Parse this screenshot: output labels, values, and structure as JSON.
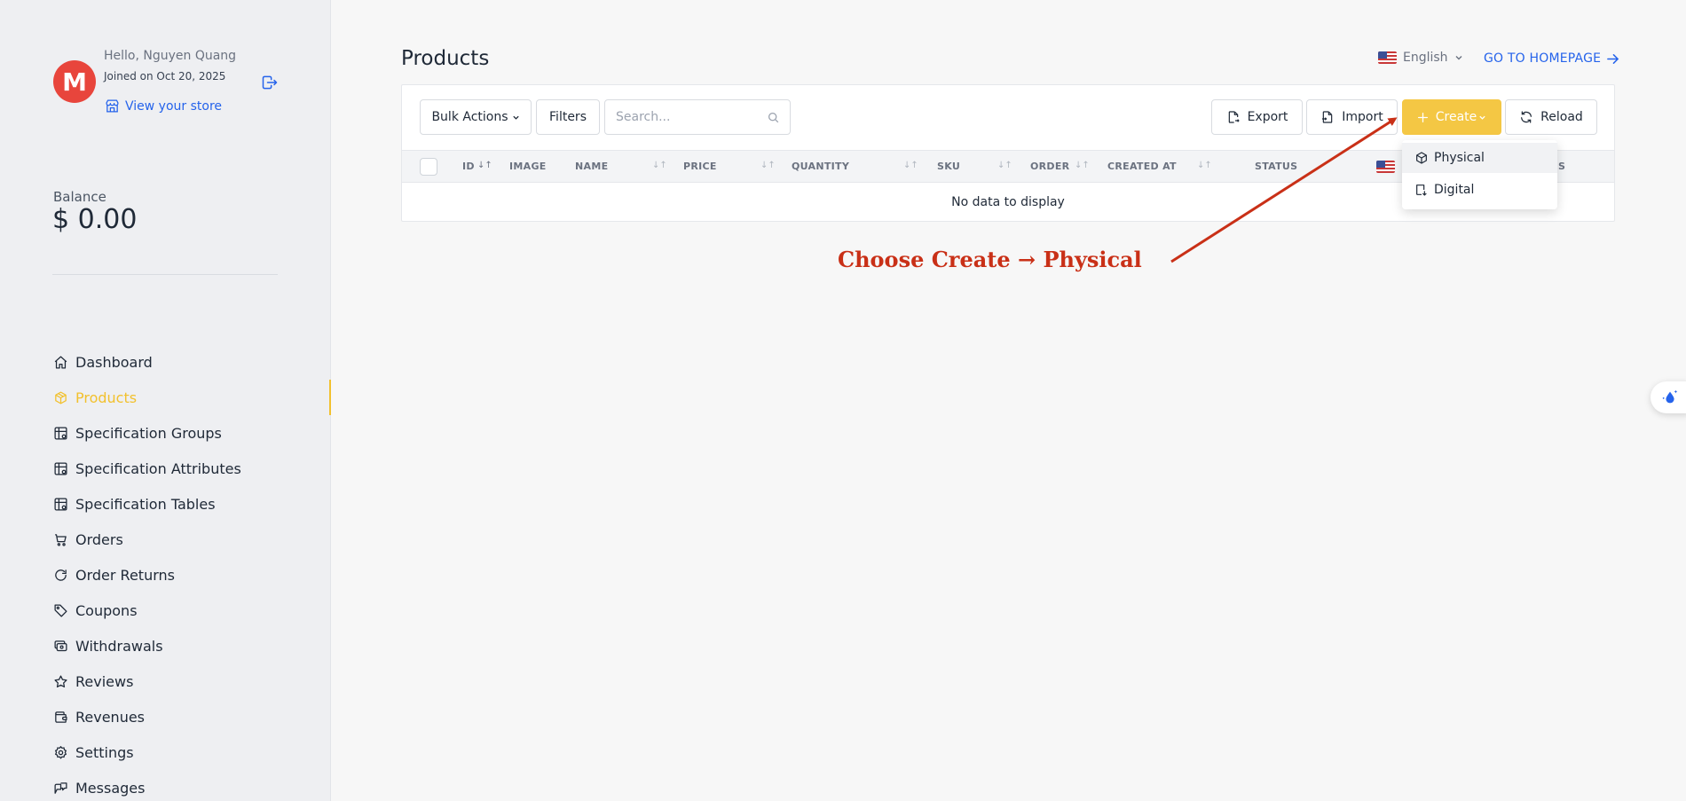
{
  "user": {
    "avatar_letter": "M",
    "greeting": "Hello, Nguyen Quang",
    "joined": "Joined on Oct 20, 2025",
    "store_link": "View your store"
  },
  "balance": {
    "label": "Balance",
    "value": "$ 0.00"
  },
  "nav": [
    {
      "label": "Dashboard",
      "icon": "home-icon"
    },
    {
      "label": "Products",
      "icon": "package-icon",
      "active": true
    },
    {
      "label": "Specification Groups",
      "icon": "table-gear-icon"
    },
    {
      "label": "Specification Attributes",
      "icon": "table-gear-icon"
    },
    {
      "label": "Specification Tables",
      "icon": "table-gear-icon"
    },
    {
      "label": "Orders",
      "icon": "cart-icon"
    },
    {
      "label": "Order Returns",
      "icon": "refresh-icon"
    },
    {
      "label": "Coupons",
      "icon": "tag-icon"
    },
    {
      "label": "Withdrawals",
      "icon": "cash-icon"
    },
    {
      "label": "Reviews",
      "icon": "star-icon"
    },
    {
      "label": "Revenues",
      "icon": "wallet-icon"
    },
    {
      "label": "Settings",
      "icon": "gear-icon"
    },
    {
      "label": "Messages",
      "icon": "message-icon"
    }
  ],
  "header": {
    "title": "Products",
    "language": "English",
    "home_link": "GO TO HOMEPAGE"
  },
  "toolbar": {
    "bulk_actions": "Bulk Actions",
    "filters": "Filters",
    "search_placeholder": "Search...",
    "export": "Export",
    "import": "Import",
    "create": "Create",
    "reload": "Reload"
  },
  "table": {
    "columns": [
      "ID",
      "IMAGE",
      "NAME",
      "PRICE",
      "QUANTITY",
      "SKU",
      "ORDER",
      "CREATED AT",
      "STATUS"
    ],
    "empty": "No data to display",
    "hidden_column_tail": "S"
  },
  "create_menu": {
    "items": [
      {
        "label": "Physical",
        "icon": "box-icon",
        "highlighted": true
      },
      {
        "label": "Digital",
        "icon": "digital-file-icon"
      }
    ]
  },
  "annotation": {
    "text": "Choose Create  →  Physical",
    "color": "#c93017"
  },
  "colors": {
    "accent": "#f4c744",
    "link": "#2563eb",
    "avatar": "#e8453c"
  }
}
